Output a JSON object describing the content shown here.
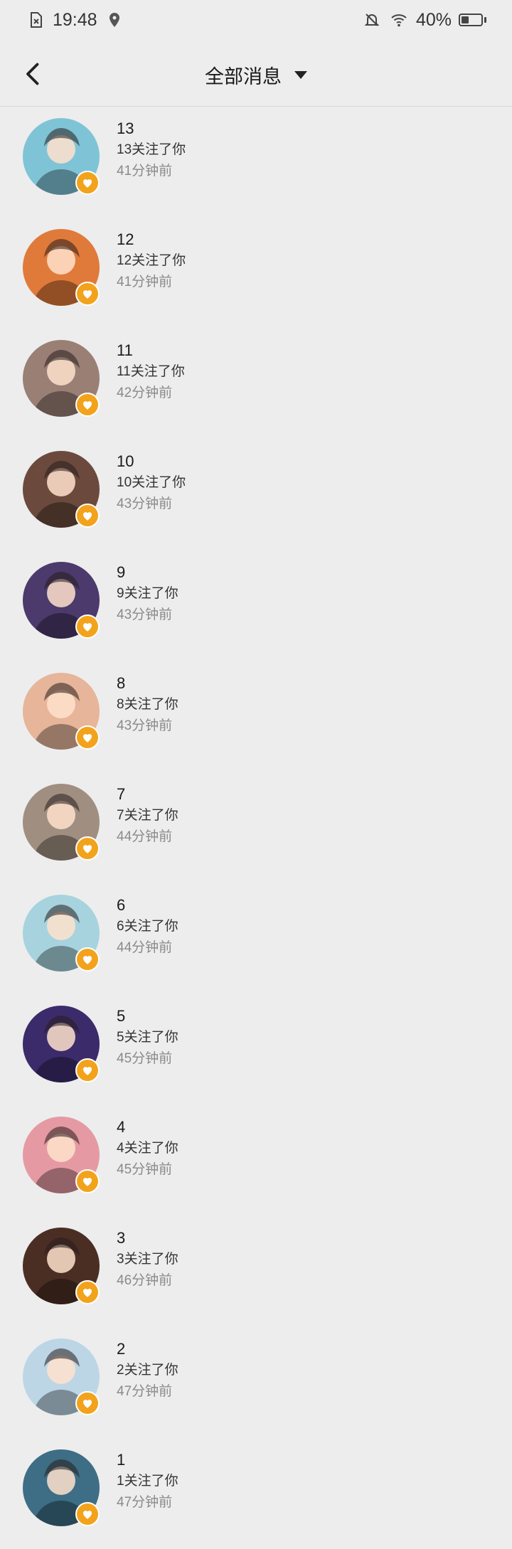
{
  "status_bar": {
    "time": "19:48",
    "battery": "40%",
    "battery_level": 0.4,
    "icons": [
      "sim-error-icon",
      "location-icon",
      "mute-bell-icon",
      "wifi-icon",
      "battery-icon"
    ]
  },
  "header": {
    "title": "全部消息",
    "back_icon": "chevron-left-icon",
    "dropdown_icon": "triangle-down-icon"
  },
  "colors": {
    "background": "#ededed",
    "badge": "#f2a31b"
  },
  "items": [
    {
      "name": "13",
      "message": "13关注了你",
      "time": "41分钟前",
      "avatar_color": "#7fc4d6"
    },
    {
      "name": "12",
      "message": "12关注了你",
      "time": "41分钟前",
      "avatar_color": "#e07a3a"
    },
    {
      "name": "11",
      "message": "11关注了你",
      "time": "42分钟前",
      "avatar_color": "#9a7f75"
    },
    {
      "name": "10",
      "message": "10关注了你",
      "time": "43分钟前",
      "avatar_color": "#6b4a3d"
    },
    {
      "name": "9",
      "message": "9关注了你",
      "time": "43分钟前",
      "avatar_color": "#4b3a6b"
    },
    {
      "name": "8",
      "message": "8关注了你",
      "time": "43分钟前",
      "avatar_color": "#e6b59a"
    },
    {
      "name": "7",
      "message": "7关注了你",
      "time": "44分钟前",
      "avatar_color": "#a08f80"
    },
    {
      "name": "6",
      "message": "6关注了你",
      "time": "44分钟前",
      "avatar_color": "#a7d3de"
    },
    {
      "name": "5",
      "message": "5关注了你",
      "time": "45分钟前",
      "avatar_color": "#3b2b6a"
    },
    {
      "name": "4",
      "message": "4关注了你",
      "time": "45分钟前",
      "avatar_color": "#e59aa3"
    },
    {
      "name": "3",
      "message": "3关注了你",
      "time": "46分钟前",
      "avatar_color": "#4a2e24"
    },
    {
      "name": "2",
      "message": "2关注了你",
      "time": "47分钟前",
      "avatar_color": "#bcd6e6"
    },
    {
      "name": "1",
      "message": "1关注了你",
      "time": "47分钟前",
      "avatar_color": "#3d6e85"
    }
  ]
}
